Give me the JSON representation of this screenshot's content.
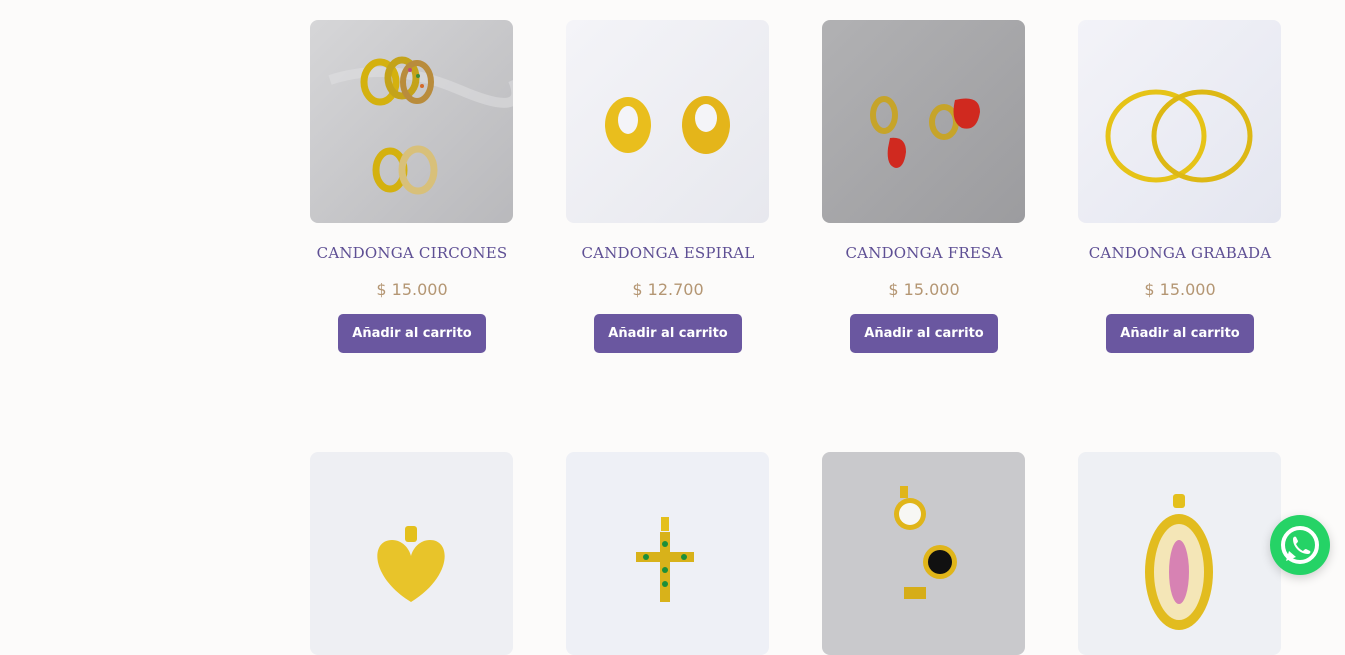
{
  "add_to_cart_label": "Añadir al carrito",
  "products": [
    {
      "name": "CANDONGA CIRCONES",
      "price": "$ 15.000",
      "image": "hoop-earrings-multicolor-stones"
    },
    {
      "name": "CANDONGA ESPIRAL",
      "price": "$ 12.700",
      "image": "spiral-gold-hoop-earrings"
    },
    {
      "name": "CANDONGA FRESA",
      "price": "$ 15.000",
      "image": "strawberry-charm-hoop-earrings"
    },
    {
      "name": "CANDONGA GRABADA",
      "price": "$ 15.000",
      "image": "engraved-gold-hoop-earrings"
    },
    {
      "name": "",
      "price": "",
      "image": "gold-heart-pendant"
    },
    {
      "name": "",
      "price": "",
      "image": "green-stone-cross-pendant"
    },
    {
      "name": "",
      "price": "",
      "image": "clover-charm-pendants"
    },
    {
      "name": "",
      "price": "",
      "image": "virgin-oval-pendant"
    }
  ],
  "colors": {
    "page_background": "#fcfbfa",
    "product_name": "#5e4f94",
    "price": "#b49673",
    "button": "#6a57a0",
    "whatsapp": "#25d366"
  },
  "whatsapp": {
    "icon": "whatsapp-icon"
  }
}
